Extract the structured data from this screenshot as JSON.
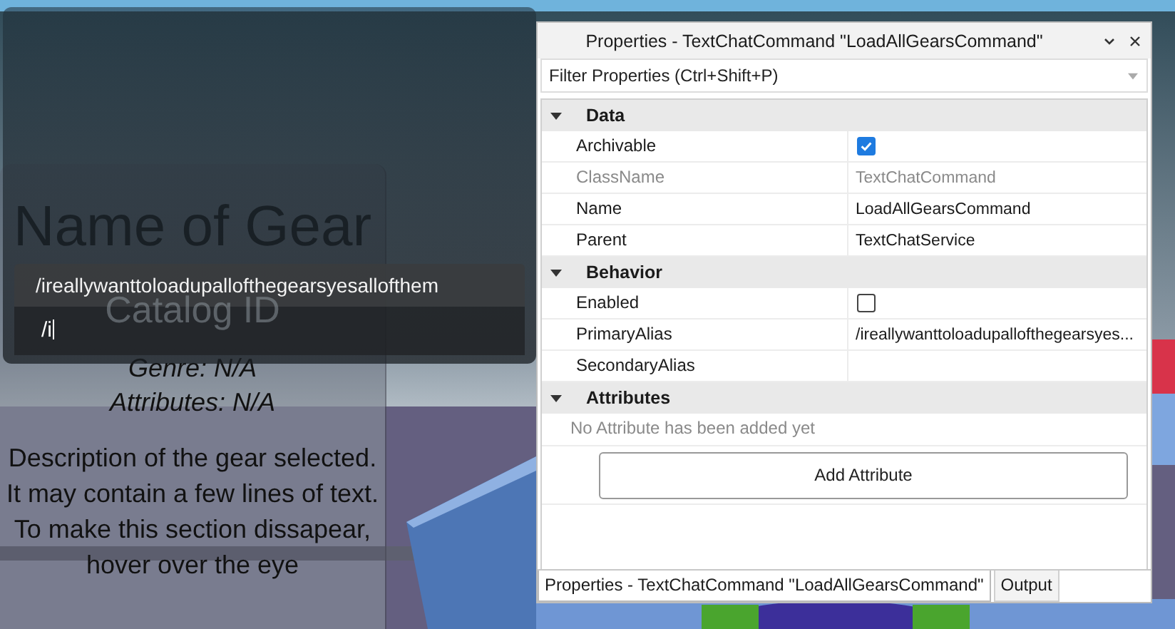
{
  "gear_panel": {
    "title": "Name of Gear",
    "catalog_id": "Catalog ID",
    "genre": "Genre: N/A",
    "attributes": "Attributes: N/A",
    "description": [
      "Description of the gear selected. It may contain a few lines of text.",
      "To make this section dissapear, hover over the eye"
    ]
  },
  "chat": {
    "messages": [
      "/ireallywanttoloadupallofthegearsyesallofthem"
    ],
    "input": {
      "value": "/i"
    }
  },
  "properties": {
    "title": "Properties - TextChatCommand \"LoadAllGearsCommand\"",
    "filter": {
      "placeholder": "Filter Properties (Ctrl+Shift+P)"
    },
    "sections": [
      {
        "name": "Data",
        "expanded": true,
        "rows": [
          {
            "name": "Archivable",
            "kind": "check",
            "checked": true,
            "disabled": false
          },
          {
            "name": "ClassName",
            "kind": "text",
            "value": "TextChatCommand",
            "disabled": true
          },
          {
            "name": "Name",
            "kind": "text",
            "value": "LoadAllGearsCommand",
            "disabled": false
          },
          {
            "name": "Parent",
            "kind": "text",
            "value": "TextChatService",
            "disabled": false
          }
        ]
      },
      {
        "name": "Behavior",
        "expanded": true,
        "rows": [
          {
            "name": "Enabled",
            "kind": "check",
            "checked": false,
            "disabled": false
          },
          {
            "name": "PrimaryAlias",
            "kind": "text",
            "value": "/ireallywanttoloadupallofthegearsyes...",
            "disabled": false
          },
          {
            "name": "SecondaryAlias",
            "kind": "text",
            "disabled": false
          }
        ]
      },
      {
        "name": "Attributes",
        "expanded": true,
        "note": "No Attribute has been added yet",
        "button": "Add Attribute"
      }
    ],
    "tabs": [
      {
        "label": "Properties - TextChatCommand \"LoadAllGearsCommand\"",
        "selected": true
      },
      {
        "label": "Output",
        "selected": false
      }
    ]
  }
}
